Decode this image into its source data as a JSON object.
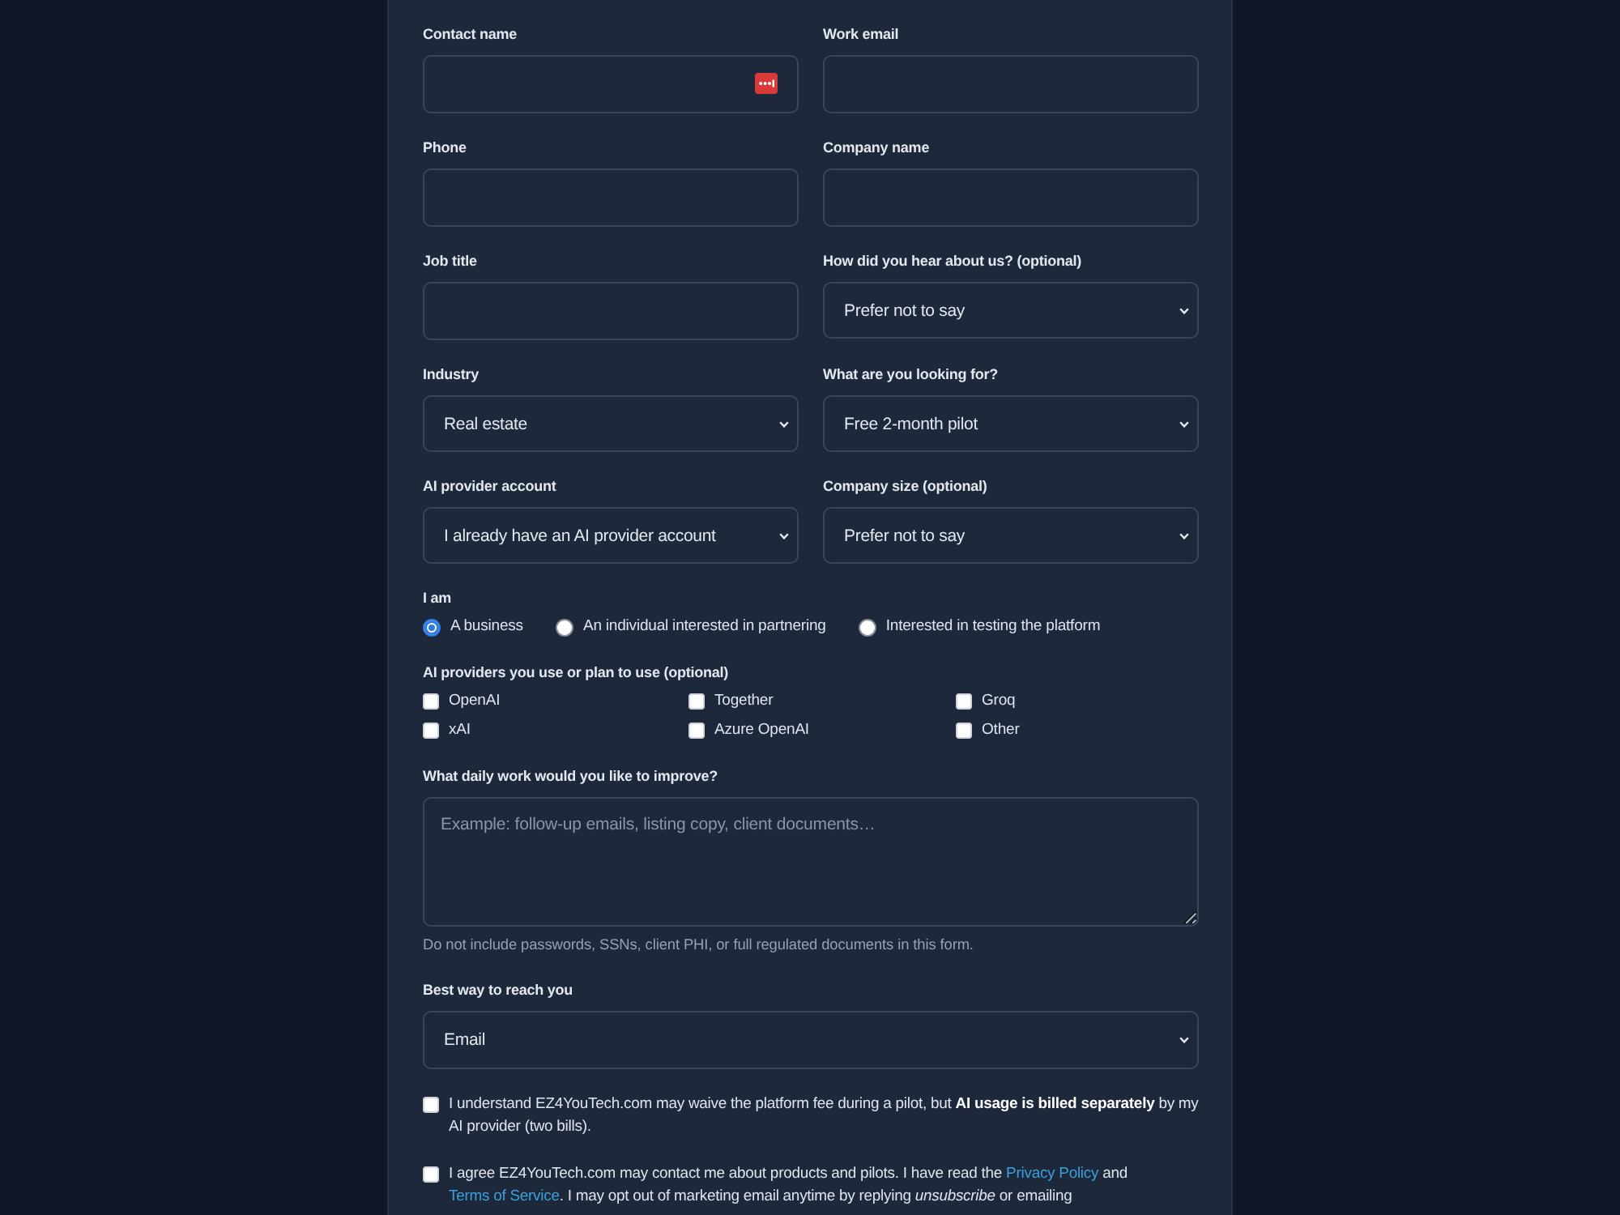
{
  "form": {
    "fields": [
      {
        "kind": "text",
        "label": "Contact name",
        "autofill_icon": true
      },
      {
        "kind": "text",
        "label": "Work email"
      },
      {
        "kind": "text",
        "label": "Phone"
      },
      {
        "kind": "text",
        "label": "Company name"
      },
      {
        "kind": "text",
        "label": "Job title"
      },
      {
        "kind": "select",
        "label": "How did you hear about us? (optional)",
        "value": "Prefer not to say"
      },
      {
        "kind": "select",
        "label": "Industry",
        "value": "Real estate"
      },
      {
        "kind": "select",
        "label": "What are you looking for?",
        "value": "Free 2-month pilot"
      },
      {
        "kind": "select",
        "label": "AI provider account",
        "value": "I already have an AI provider account"
      },
      {
        "kind": "select",
        "label": "Company size (optional)",
        "value": "Prefer not to say"
      }
    ],
    "i_am": {
      "label": "I am",
      "options": [
        {
          "label": "A business",
          "selected": true
        },
        {
          "label": "An individual interested in partnering",
          "selected": false
        },
        {
          "label": "Interested in testing the platform",
          "selected": false
        }
      ]
    },
    "ai_providers": {
      "label": "AI providers you use or plan to use (optional)",
      "options": [
        {
          "label": "OpenAI",
          "checked": false
        },
        {
          "label": "Together",
          "checked": false
        },
        {
          "label": "Groq",
          "checked": false
        },
        {
          "label": "xAI",
          "checked": false
        },
        {
          "label": "Azure OpenAI",
          "checked": false
        },
        {
          "label": "Other",
          "checked": false
        }
      ]
    },
    "daily_work": {
      "label": "What daily work would you like to improve?",
      "placeholder": "Example: follow-up emails, listing copy, client documents…",
      "hint": "Do not include passwords, SSNs, client PHI, or full regulated documents in this form."
    },
    "contact_method": {
      "label": "Best way to reach you",
      "value": "Email"
    },
    "consents": [
      {
        "checked": false,
        "parts": [
          {
            "kind": "text",
            "text": "I understand EZ4YouTech.com may waive the platform fee during a pilot, but **AI usage is billed separately** by my AI provider (two bills)."
          }
        ]
      },
      {
        "checked": false,
        "parts": [
          {
            "kind": "text",
            "text": "I agree EZ4YouTech.com may contact me about products and pilots. I have read the "
          },
          {
            "kind": "link",
            "text": "Privacy Policy"
          },
          {
            "kind": "text",
            "text": " and "
          },
          {
            "kind": "link",
            "text": "Terms of Service"
          },
          {
            "kind": "text",
            "text": ". I may opt out of marketing email anytime by replying *unsubscribe* or emailing"
          }
        ]
      }
    ]
  }
}
